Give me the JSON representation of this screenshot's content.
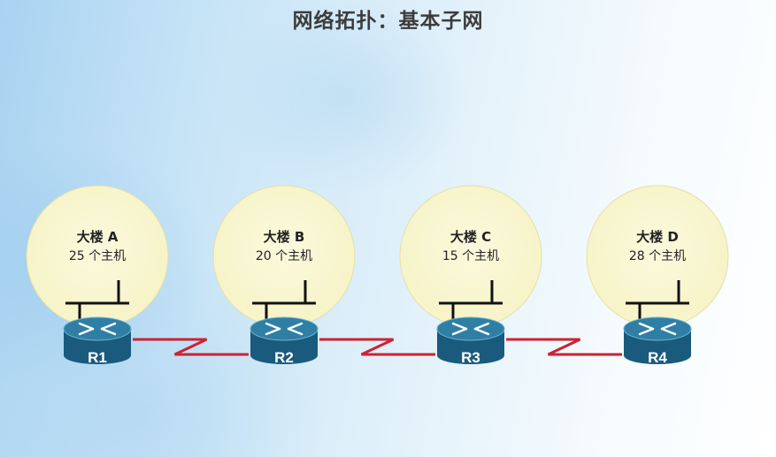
{
  "title": "网络拓扑：基本子网",
  "colors": {
    "building_fill": "#f6f3c6",
    "link": "#cc2233",
    "router_top": "#2f7fa4",
    "router_side": "#1a5a7d",
    "switch_line": "#111111"
  },
  "buildings": [
    {
      "name": "大楼 A",
      "hosts": "25 个主机",
      "router": "R1"
    },
    {
      "name": "大楼 B",
      "hosts": "20 个主机",
      "router": "R2"
    },
    {
      "name": "大楼 C",
      "hosts": "15 个主机",
      "router": "R3"
    },
    {
      "name": "大楼 D",
      "hosts": "28 个主机",
      "router": "R4"
    }
  ],
  "links": [
    {
      "from": "R1",
      "to": "R2",
      "type": "serial"
    },
    {
      "from": "R2",
      "to": "R3",
      "type": "serial"
    },
    {
      "from": "R3",
      "to": "R4",
      "type": "serial"
    }
  ]
}
